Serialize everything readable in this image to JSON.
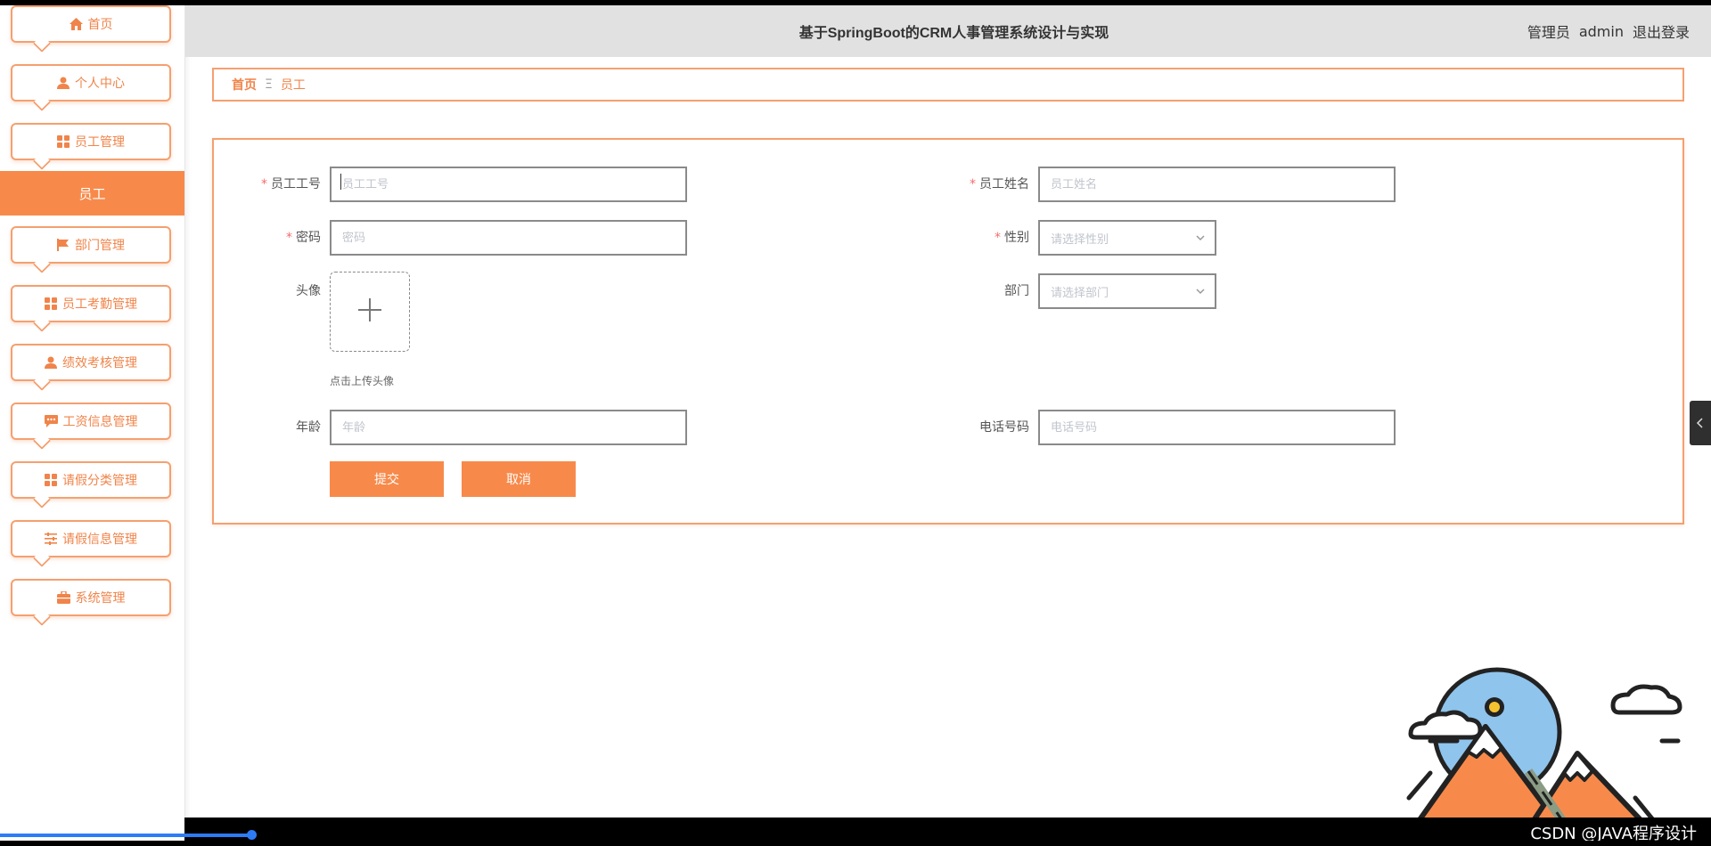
{
  "app": {
    "title": "基于SpringBoot的CRM人事管理系统设计与实现",
    "user_role": "管理员",
    "user_name": "admin",
    "logout_label": "退出登录"
  },
  "sidebar": {
    "items": [
      {
        "label": "首页",
        "icon": "home-icon"
      },
      {
        "label": "个人中心",
        "icon": "user-icon"
      },
      {
        "label": "员工管理",
        "icon": "grid-icon"
      },
      {
        "label": "员工",
        "active": true
      },
      {
        "label": "部门管理",
        "icon": "flag-icon"
      },
      {
        "label": "员工考勤管理",
        "icon": "grid-icon"
      },
      {
        "label": "绩效考核管理",
        "icon": "user-icon"
      },
      {
        "label": "工资信息管理",
        "icon": "chat-icon"
      },
      {
        "label": "请假分类管理",
        "icon": "grid-icon"
      },
      {
        "label": "请假信息管理",
        "icon": "sliders-icon"
      },
      {
        "label": "系统管理",
        "icon": "briefcase-icon"
      }
    ]
  },
  "breadcrumb": {
    "home": "首页",
    "separator": "Ξ",
    "current": "员工"
  },
  "form": {
    "employee_no": {
      "label": "员工工号",
      "placeholder": "员工工号",
      "required": true
    },
    "employee_name": {
      "label": "员工姓名",
      "placeholder": "员工姓名",
      "required": true
    },
    "password": {
      "label": "密码",
      "placeholder": "密码",
      "required": true
    },
    "gender": {
      "label": "性别",
      "placeholder": "请选择性别",
      "required": true
    },
    "avatar": {
      "label": "头像",
      "tip": "点击上传头像"
    },
    "department": {
      "label": "部门",
      "placeholder": "请选择部门"
    },
    "age": {
      "label": "年龄",
      "placeholder": "年龄"
    },
    "phone": {
      "label": "电话号码",
      "placeholder": "电话号码"
    },
    "submit_label": "提交",
    "cancel_label": "取消"
  },
  "footer": {
    "watermark": "CSDN @JAVA程序设计"
  },
  "colors": {
    "accent": "#f78a4b",
    "border": "#f4a070",
    "header_bg": "#e2e1e1",
    "required": "#f56c6c"
  }
}
